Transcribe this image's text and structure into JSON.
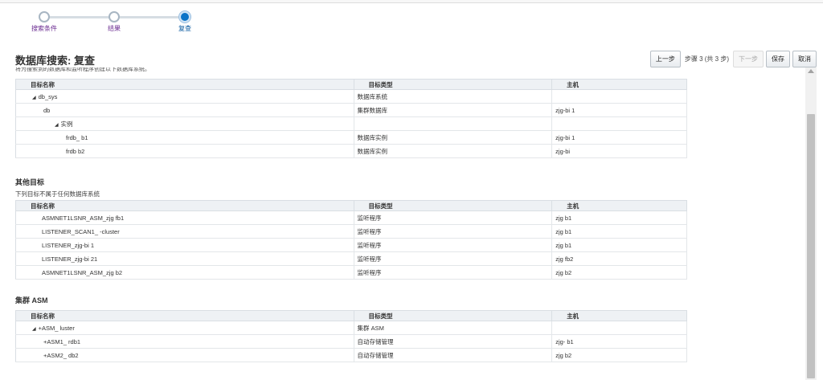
{
  "train": {
    "steps": [
      {
        "label": "搜索条件"
      },
      {
        "label": "结果"
      },
      {
        "label": "复查"
      }
    ]
  },
  "page_title": "数据库搜索: 复查",
  "toolbar": {
    "back_label": "上一步",
    "step_info": "步骤 3 (共 3 步)",
    "next_label": "下一步",
    "save_label": "保存",
    "cancel_label": "取消"
  },
  "intro_text": "将为搜索到的数据库和监听程序创建以下数据库系统。",
  "columns": {
    "name": "目标名称",
    "type": "目标类型",
    "host": "主机"
  },
  "db_system_table": {
    "rows": [
      {
        "name": "db_sys",
        "type": "数据库系统",
        "host": "",
        "indent": 1,
        "expand": true
      },
      {
        "name": "db",
        "type": "集群数据库",
        "host": "zjg-bi 1",
        "indent": 2,
        "expand": false
      },
      {
        "name": "实例",
        "type": "",
        "host": "",
        "indent": 3,
        "expand": true
      },
      {
        "name": "frdb_ b1",
        "type": "数据库实例",
        "host": "zjg-bi 1",
        "indent": 4,
        "expand": false
      },
      {
        "name": "frdb b2",
        "type": "数据库实例",
        "host": "zjg-bi",
        "indent": 4,
        "expand": false
      }
    ]
  },
  "other_targets": {
    "title": "其他目标",
    "desc": "下列目标不属于任何数据库系统",
    "rows": [
      {
        "name": "ASMNET1LSNR_ASM_zjg fb1",
        "type": "监听程序",
        "host": "zjg b1"
      },
      {
        "name": "LISTENER_SCAN1_ -cluster",
        "type": "监听程序",
        "host": "zjg b1"
      },
      {
        "name": "LISTENER_zjg-bi 1",
        "type": "监听程序",
        "host": "zjg b1"
      },
      {
        "name": "LISTENER_zjg-bi 21",
        "type": "监听程序",
        "host": "zjg fb2"
      },
      {
        "name": "ASMNET1LSNR_ASM_zjg b2",
        "type": "监听程序",
        "host": "zjg b2"
      }
    ]
  },
  "cluster_asm": {
    "title": "集群 ASM",
    "rows": [
      {
        "name": "+ASM_ luster",
        "type": "集群 ASM",
        "host": "",
        "indent": 1,
        "expand": true
      },
      {
        "name": "+ASM1_ rdb1",
        "type": "自动存储管理",
        "host": "zjg- b1",
        "indent": 2,
        "expand": false
      },
      {
        "name": "+ASM2_ db2",
        "type": "自动存储管理",
        "host": "zjg b2",
        "indent": 2,
        "expand": false
      }
    ]
  }
}
